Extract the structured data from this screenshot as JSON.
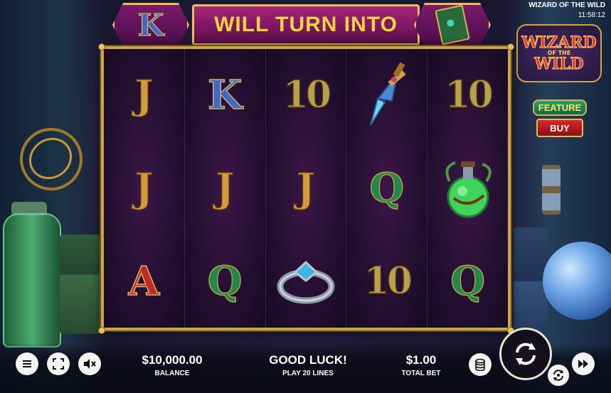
{
  "game": {
    "title": "WIZARD OF THE WILD",
    "clock": "11:58:12"
  },
  "banner": {
    "text": "WILL TURN INTO",
    "left_symbol": "K",
    "right_symbol": "spellbook-icon"
  },
  "logo": {
    "line1": "WIZARD",
    "line2": "OF THE",
    "line3": "WILD"
  },
  "feature": {
    "label": "FEATURE",
    "buy_label": "BUY"
  },
  "reels": [
    [
      "J",
      "J",
      "A"
    ],
    [
      "K",
      "J",
      "Q"
    ],
    [
      "10",
      "J",
      "ring-icon"
    ],
    [
      "dagger-icon",
      "Q",
      "10"
    ],
    [
      "10",
      "potion-icon",
      "Q"
    ]
  ],
  "bottom": {
    "balance_value": "$10,000.00",
    "balance_label": "BALANCE",
    "message": "GOOD LUCK!",
    "lines_label": "PLAY 20 LINES",
    "bet_value": "$1.00",
    "bet_label": "TOTAL BET"
  },
  "icons": {
    "menu": "menu-icon",
    "fullscreen": "fullscreen-icon",
    "sound": "sound-muted-icon",
    "stake": "coin-stack-icon",
    "spin": "spin-icon",
    "autoplay": "autoplay-icon",
    "turbo": "fast-forward-icon"
  },
  "colors": {
    "frame_gold": "#c9a64a",
    "banner_text": "#ffd24a",
    "buy_red": "#d8272d",
    "feature_green": "#2aa36a"
  }
}
